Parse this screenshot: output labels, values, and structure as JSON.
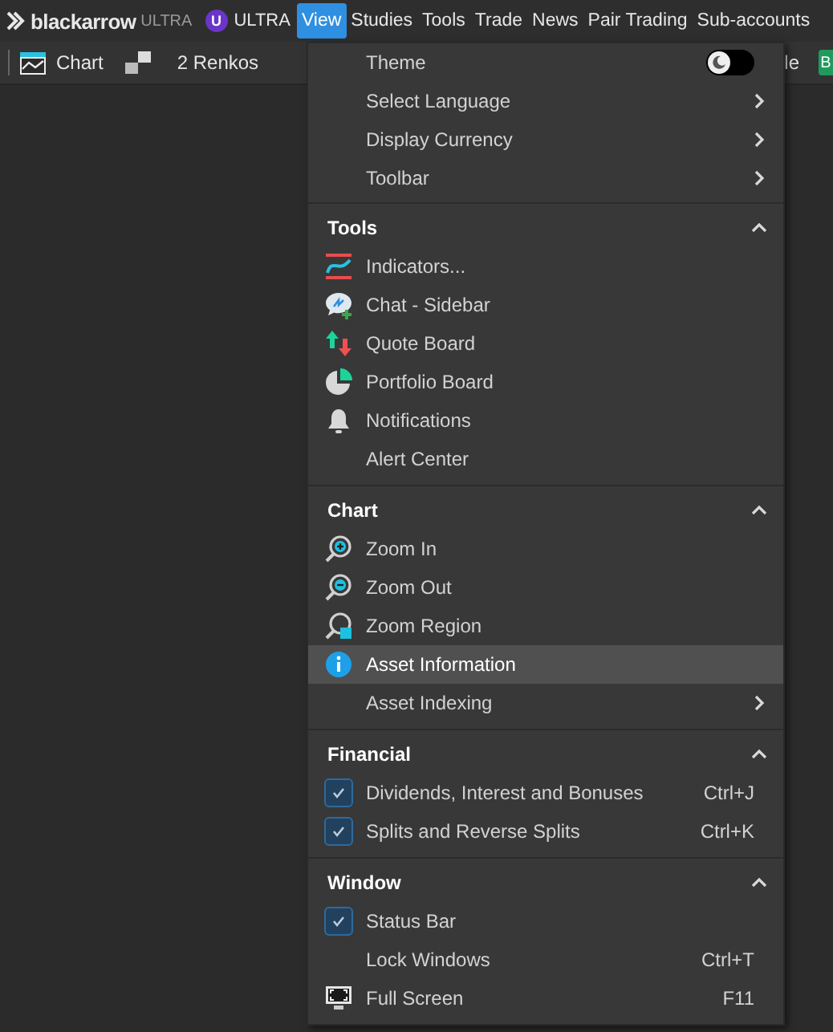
{
  "app": {
    "logo_main": "blackarrow",
    "logo_sub": "ULTRA",
    "plan_badge": "U",
    "plan_label": "ULTRA"
  },
  "menubar": [
    {
      "label": "View",
      "selected": true
    },
    {
      "label": "Studies",
      "selected": false
    },
    {
      "label": "Tools",
      "selected": false
    },
    {
      "label": "Trade",
      "selected": false
    },
    {
      "label": "News",
      "selected": false
    },
    {
      "label": "Pair Trading",
      "selected": false
    },
    {
      "label": "Sub-accounts",
      "selected": false
    }
  ],
  "toolbar": {
    "chart_label": "Chart",
    "renko_label": "2 Renkos",
    "cut_text": "le",
    "cut_button": "B"
  },
  "menu": {
    "sections": [
      {
        "items": [
          {
            "kind": "toggle",
            "label": "Theme",
            "on": false
          },
          {
            "kind": "submenu",
            "label": "Select Language"
          },
          {
            "kind": "submenu",
            "label": "Display Currency"
          },
          {
            "kind": "submenu",
            "label": "Toolbar"
          }
        ]
      },
      {
        "title": "Tools",
        "expanded": true,
        "items": [
          {
            "kind": "icon",
            "label": "Indicators..."
          },
          {
            "kind": "icon",
            "label": "Chat - Sidebar"
          },
          {
            "kind": "icon",
            "label": "Quote Board"
          },
          {
            "kind": "icon",
            "label": "Portfolio Board"
          },
          {
            "kind": "icon",
            "label": "Notifications"
          },
          {
            "kind": "plain",
            "label": "Alert Center"
          }
        ]
      },
      {
        "title": "Chart",
        "expanded": true,
        "items": [
          {
            "kind": "icon",
            "label": "Zoom In",
            "selected": false
          },
          {
            "kind": "icon",
            "label": "Zoom Out",
            "selected": false
          },
          {
            "kind": "icon",
            "label": "Zoom Region",
            "selected": false
          },
          {
            "kind": "icon",
            "label": "Asset Information",
            "selected": true
          },
          {
            "kind": "submenu",
            "label": "Asset Indexing",
            "selected": false
          }
        ]
      },
      {
        "title": "Financial",
        "expanded": true,
        "items": [
          {
            "kind": "check",
            "label": "Dividends, Interest and Bonuses",
            "checked": true,
            "shortcut": "Ctrl+J"
          },
          {
            "kind": "check",
            "label": "Splits and Reverse Splits",
            "checked": true,
            "shortcut": "Ctrl+K"
          }
        ]
      },
      {
        "title": "Window",
        "expanded": true,
        "items": [
          {
            "kind": "check",
            "label": "Status Bar",
            "checked": true
          },
          {
            "kind": "plain",
            "label": "Lock Windows",
            "shortcut": "Ctrl+T"
          },
          {
            "kind": "icon",
            "label": "Full Screen",
            "shortcut": "F11"
          }
        ]
      }
    ]
  }
}
